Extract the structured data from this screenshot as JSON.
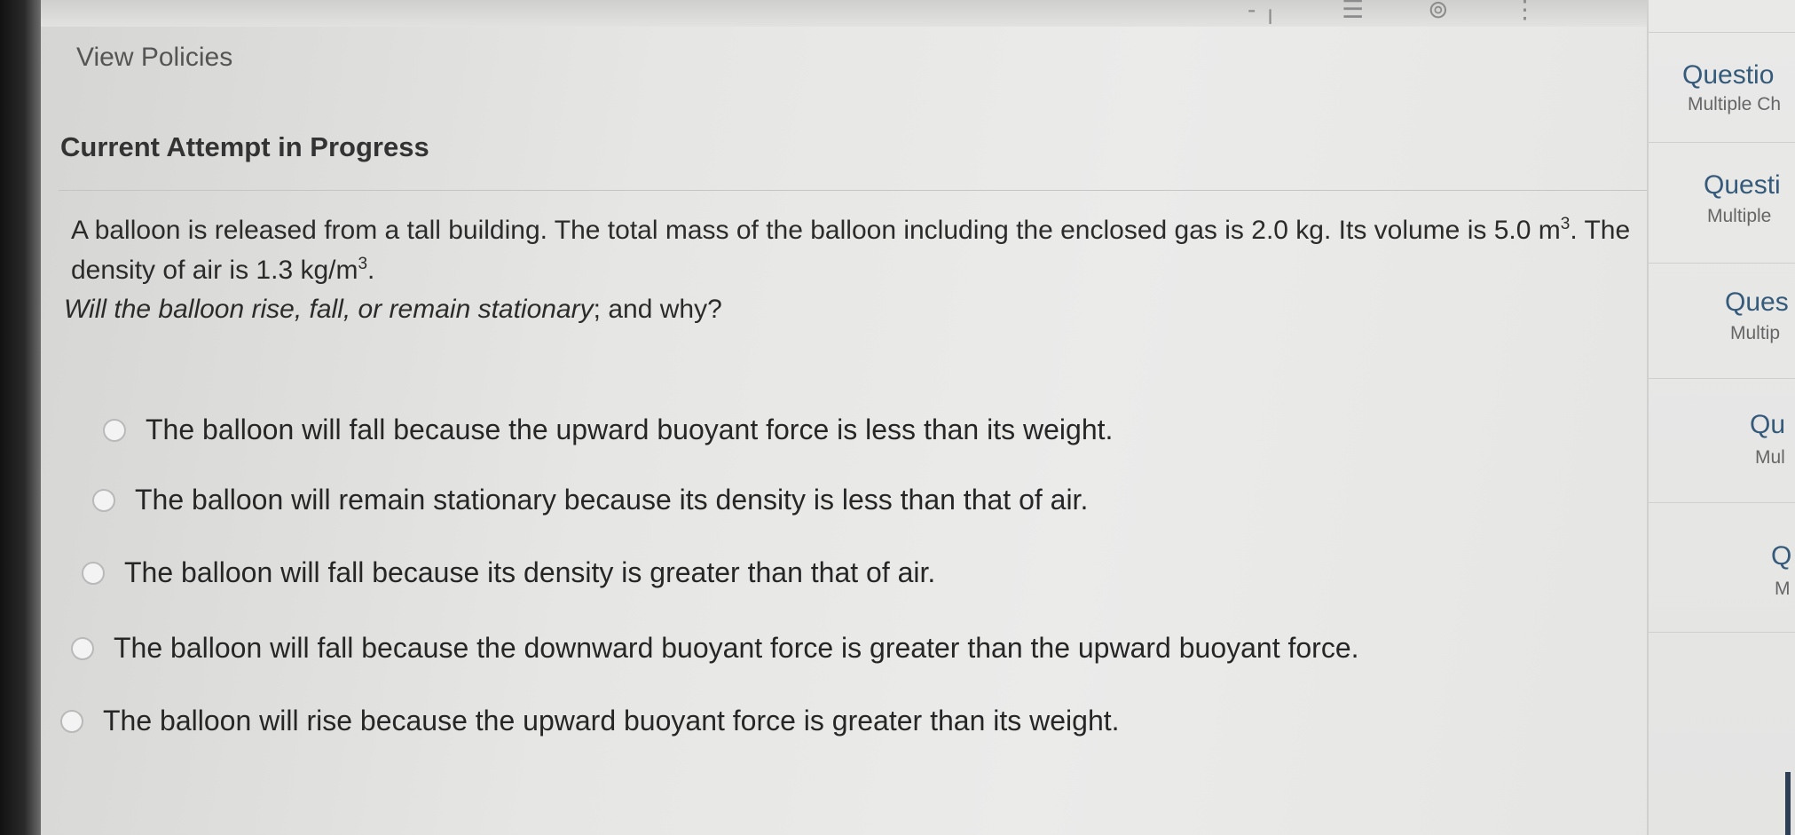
{
  "header": {
    "view_policies": "View Policies"
  },
  "toolbar": {
    "icons": [
      "minus-icon",
      "list-icon",
      "attachment-icon",
      "more-icon"
    ]
  },
  "attempt": {
    "title": "Current Attempt in Progress"
  },
  "question": {
    "text_part1": "A balloon is released from a tall building. The total mass of the balloon including the enclosed gas is 2.0 kg. Its volume is 5.0 m",
    "text_sup1": "3",
    "text_part2": ". The density of air is 1.3 kg/m",
    "text_sup2": "3",
    "text_part3": ".",
    "prompt_italic": "Will the balloon rise, fall, or remain stationary",
    "prompt_rest": "; and why?"
  },
  "options": [
    {
      "label": "The balloon will fall because the upward buoyant force is less than its weight."
    },
    {
      "label": "The balloon will remain stationary because its density is less than that of air."
    },
    {
      "label": "The balloon will fall because its density is greater than that of air."
    },
    {
      "label": "The balloon will fall because the downward buoyant force is greater than the upward buoyant force."
    },
    {
      "label": "The balloon will rise because the upward buoyant force is greater than its weight."
    }
  ],
  "sidebar": {
    "items": [
      {
        "title": "Questio",
        "sub": "Multiple Ch"
      },
      {
        "title": "Questi",
        "sub": "Multiple"
      },
      {
        "title": "Ques",
        "sub": "Multip"
      },
      {
        "title": "Qu",
        "sub": "Mul"
      },
      {
        "title": "Q",
        "sub": "M"
      }
    ]
  },
  "colors": {
    "sidebar_title": "#355a7a",
    "text": "#2a2a2a"
  }
}
